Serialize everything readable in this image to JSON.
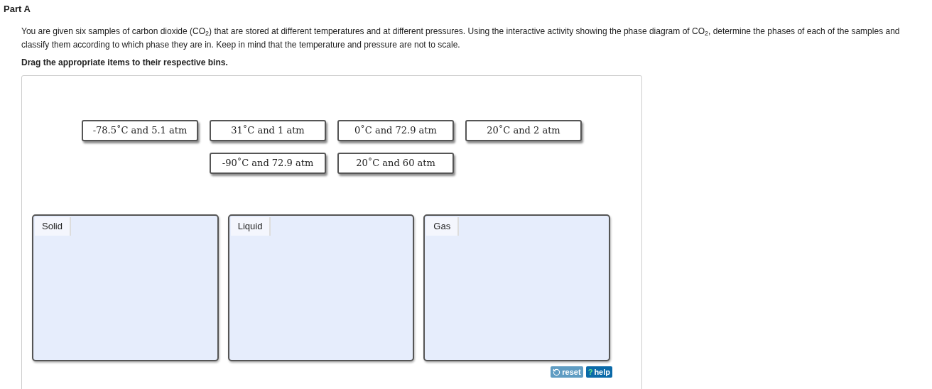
{
  "heading": "Part A",
  "intro": "You are given six samples of carbon dioxide (CO$_{2}$) that are stored at different temperatures and at different pressures. Using the interactive activity showing the phase diagram of CO$_{2}$, determine the phases of each of the samples and classify them according to which phase they are in. Keep in mind that the temperature and pressure are not to scale.",
  "instruction": "Drag the appropriate items to their respective bins.",
  "items": [
    "-78.5˚C and 5.1 atm",
    "31˚C and 1 atm",
    "0˚C and 72.9 atm",
    "20˚C and 2 atm",
    "-90˚C and 72.9 atm",
    "20˚C and 60 atm"
  ],
  "bins": [
    {
      "label": "Solid"
    },
    {
      "label": "Liquid"
    },
    {
      "label": "Gas"
    }
  ],
  "buttons": [
    {
      "kind": "reset",
      "label": "reset",
      "disabled": true
    },
    {
      "kind": "help",
      "label": "help",
      "icon": "?",
      "disabled": false
    }
  ]
}
